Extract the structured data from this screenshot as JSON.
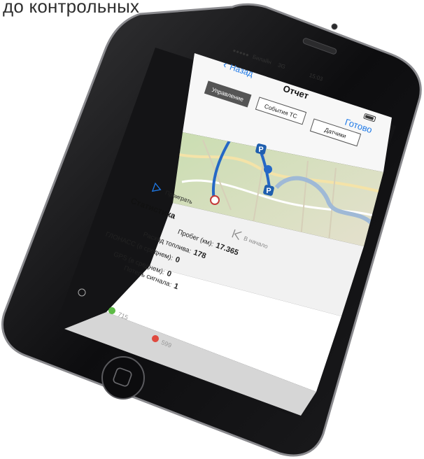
{
  "caption": "до контрольных",
  "status_bar": {
    "carrier": "Билайн",
    "network": "3G",
    "time": "15:03"
  },
  "nav": {
    "back_label": "Назад",
    "title": "Отчет",
    "done_label": "Готово"
  },
  "tabs": [
    {
      "label": "Управление"
    },
    {
      "label": "События ТС"
    },
    {
      "label": "Датчики"
    }
  ],
  "map": {
    "parking_label": "P"
  },
  "controls": {
    "play_label": "Проиграть",
    "rewind_label": "В начало"
  },
  "stats": {
    "title": "Статистика",
    "rows": [
      {
        "label": "Пробег (км):",
        "value": "17.365"
      },
      {
        "label": "Расход топлива:",
        "value": "178"
      },
      {
        "label": "ГЛОНАСС (в среднем):",
        "value": "0"
      },
      {
        "label": "GPS (в среднем):",
        "value": "0"
      },
      {
        "label": "Потерь сигнала:",
        "value": "1"
      }
    ]
  },
  "bottom_bar": {
    "green_count": "715",
    "red_count": "599"
  },
  "colors": {
    "ios_blue": "#1f7ae8",
    "route": "#2568c6",
    "map_green": "#bcd6a1"
  }
}
